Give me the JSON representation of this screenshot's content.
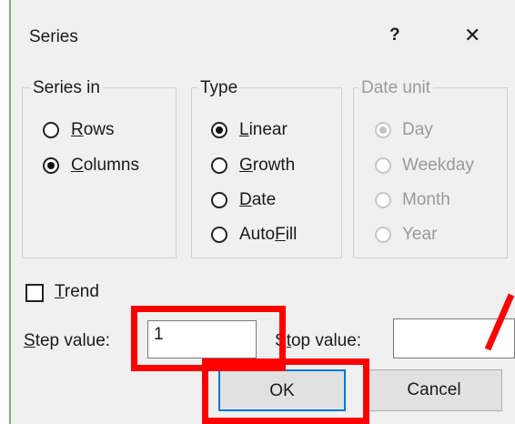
{
  "dialog": {
    "title": "Series",
    "help": "?",
    "close": "✕"
  },
  "series_in": {
    "legend": "Series in",
    "rows_pre": "",
    "rows_u": "R",
    "rows_post": "ows",
    "columns_pre": "",
    "columns_u": "C",
    "columns_post": "olumns",
    "selected": "Columns"
  },
  "type": {
    "legend": "Type",
    "linear_u": "L",
    "linear_post": "inear",
    "growth_u": "G",
    "growth_post": "rowth",
    "date_u": "D",
    "date_post": "ate",
    "autofill_pre": "Auto",
    "autofill_u": "F",
    "autofill_post": "ill",
    "selected": "Linear"
  },
  "date_unit": {
    "legend": "Date unit",
    "day": "Day",
    "weekday": "Weekday",
    "month": "Month",
    "year": "Year",
    "selected": "Day",
    "disabled": true
  },
  "trend": {
    "label_u": "T",
    "label_post": "rend",
    "checked": false
  },
  "step": {
    "label_u": "S",
    "label_post": "tep value:",
    "value": "1"
  },
  "stop": {
    "label_pre": "S",
    "label_u": "t",
    "label_post": "op value:",
    "value": ""
  },
  "buttons": {
    "ok": "OK",
    "cancel": "Cancel"
  },
  "colors": {
    "highlight": "#ff0000",
    "dialog_bg": "#f0f0f0",
    "left_border": "#7fb77e"
  }
}
